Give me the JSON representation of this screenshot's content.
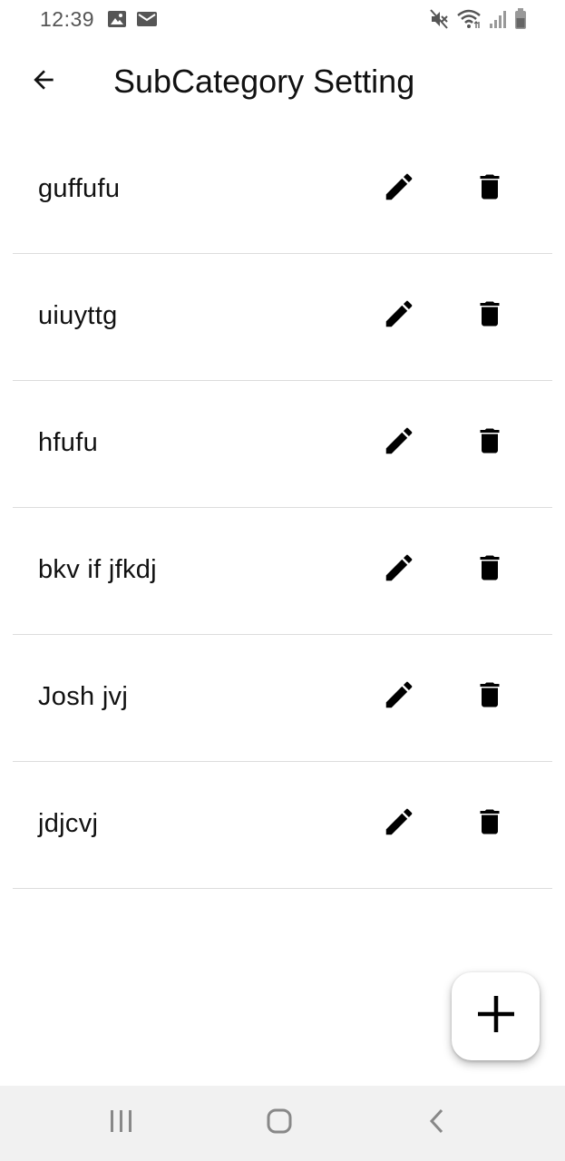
{
  "status_bar": {
    "time": "12:39",
    "left_icons": [
      "image-icon",
      "mail-icon"
    ],
    "right_icons": [
      "mute-icon",
      "wifi-icon",
      "signal-icon",
      "battery-icon"
    ]
  },
  "app_bar": {
    "back_icon": "arrow-left-icon",
    "title": "SubCategory Setting"
  },
  "list": {
    "items": [
      {
        "label": "guffufu"
      },
      {
        "label": "uiuyttg"
      },
      {
        "label": "hfufu"
      },
      {
        "label": "bkv if jfkdj"
      },
      {
        "label": "Josh jvj"
      },
      {
        "label": "jdjcvj"
      }
    ],
    "edit_icon": "pencil-icon",
    "delete_icon": "trash-icon"
  },
  "fab": {
    "icon": "plus-icon"
  },
  "nav_bar": {
    "buttons": [
      "recent-apps-icon",
      "home-icon",
      "back-chevron-icon"
    ],
    "background": "#f1f1f1"
  },
  "colors": {
    "text": "#111111",
    "divider": "#dcdcdc",
    "status_text": "#555555"
  }
}
